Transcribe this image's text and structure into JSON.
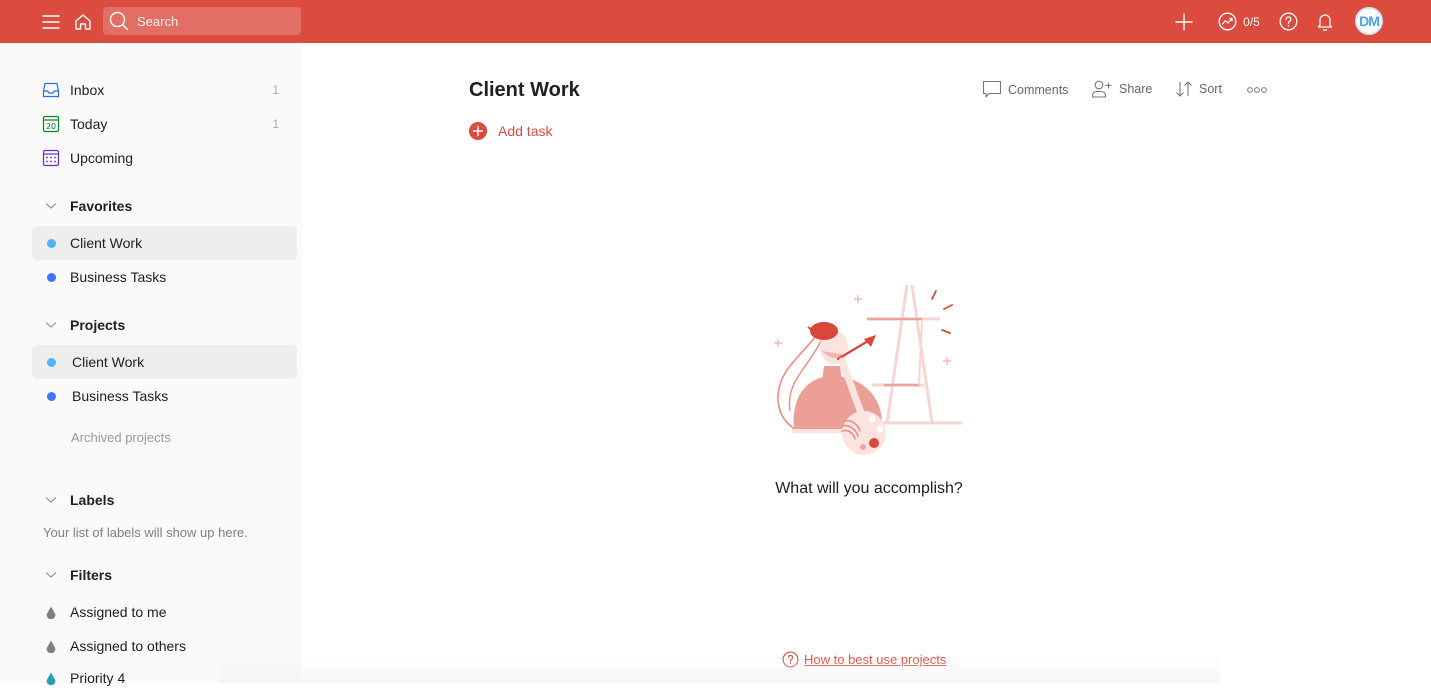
{
  "topbar": {
    "search_placeholder": "Search",
    "karma": "0/5",
    "avatar_initials": "DM",
    "brand_color": "#db4c3f"
  },
  "sidebar": {
    "main_nav": [
      {
        "label": "Inbox",
        "count": "1",
        "icon": "inbox-icon"
      },
      {
        "label": "Today",
        "count": "1",
        "icon": "calendar-today-icon",
        "icon_text": "20"
      },
      {
        "label": "Upcoming",
        "count": "",
        "icon": "calendar-upcoming-icon"
      }
    ],
    "favorites": {
      "title": "Favorites",
      "items": [
        {
          "label": "Client Work",
          "color": "#4fb3f6",
          "active": true
        },
        {
          "label": "Business Tasks",
          "color": "#4073ff",
          "active": false
        }
      ]
    },
    "projects": {
      "title": "Projects",
      "items": [
        {
          "label": "Client Work",
          "color": "#4fb3f6",
          "active": true
        },
        {
          "label": "Business Tasks",
          "color": "#4073ff",
          "active": false
        }
      ],
      "archived_label": "Archived projects"
    },
    "labels": {
      "title": "Labels",
      "empty_text": "Your list of labels will show up here."
    },
    "filters": {
      "title": "Filters",
      "items": [
        {
          "label": "Assigned to me",
          "icon": "filter-drop-icon",
          "color": "#808080"
        },
        {
          "label": "Assigned to others",
          "icon": "filter-drop-icon",
          "color": "#808080"
        },
        {
          "label": "Priority 4",
          "icon": "filter-drop-icon",
          "color": "#299fb1"
        }
      ]
    }
  },
  "main": {
    "title": "Client Work",
    "add_task_label": "Add task",
    "toolbar": {
      "comments_label": "Comments",
      "share_label": "Share",
      "sort_label": "Sort"
    },
    "empty_state": {
      "text": "What will you accomplish?",
      "help_link": "How to best use projects"
    }
  }
}
